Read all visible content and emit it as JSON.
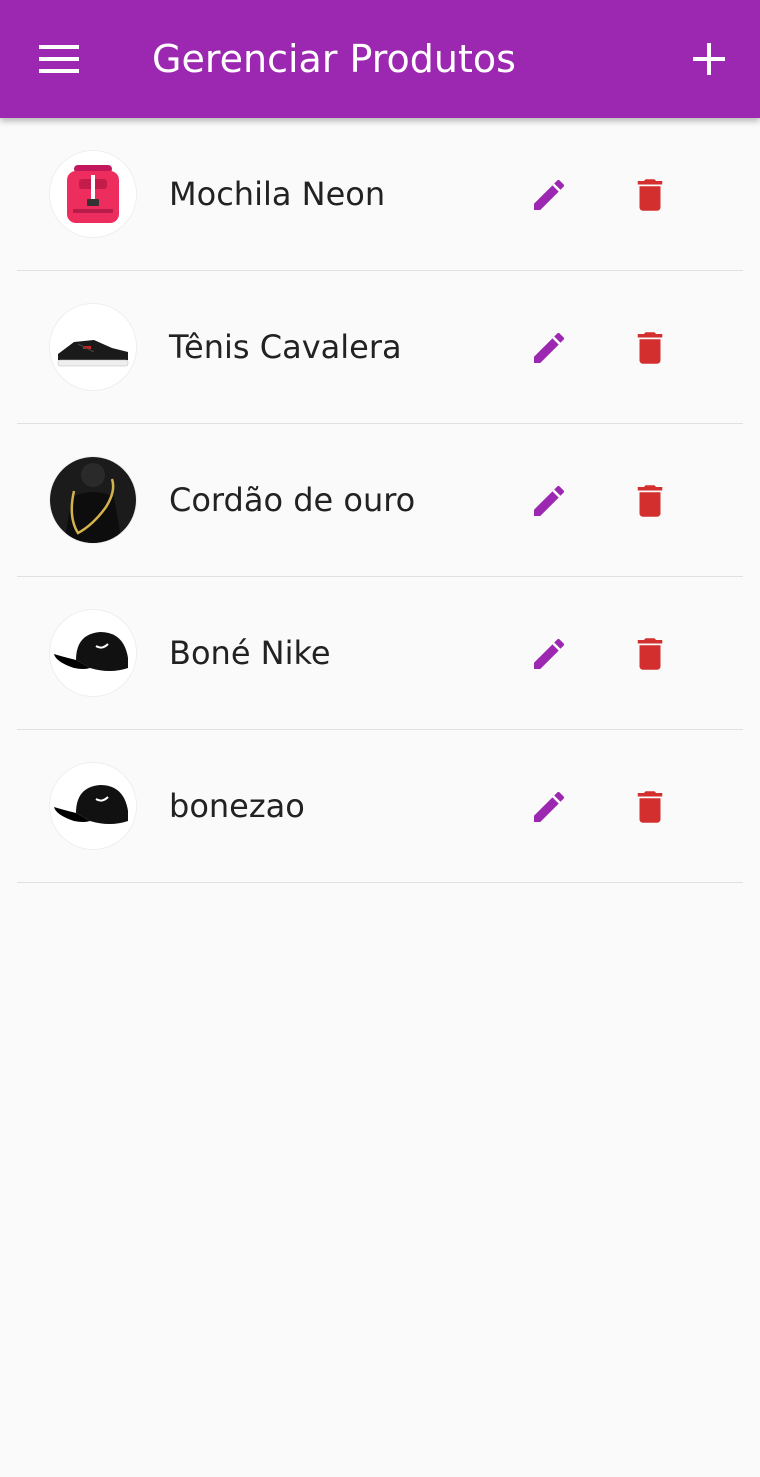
{
  "app_bar": {
    "title": "Gerenciar Produtos",
    "background_color": "#9c27b0",
    "menu_icon": "menu-icon",
    "add_icon": "plus-icon"
  },
  "colors": {
    "edit_icon": "#9c27b0",
    "delete_icon": "#d32f2f",
    "text": "#222222",
    "divider": "#e0e0e0"
  },
  "products": [
    {
      "name": "Mochila Neon",
      "image_icon": "backpack-image"
    },
    {
      "name": "Tênis Cavalera",
      "image_icon": "sneaker-image"
    },
    {
      "name": "Cordão de ouro",
      "image_icon": "gold-chain-image"
    },
    {
      "name": "Boné Nike",
      "image_icon": "cap-image"
    },
    {
      "name": "bonezao",
      "image_icon": "cap-image"
    }
  ],
  "row_actions": {
    "edit_icon": "pencil-icon",
    "delete_icon": "trash-icon"
  }
}
